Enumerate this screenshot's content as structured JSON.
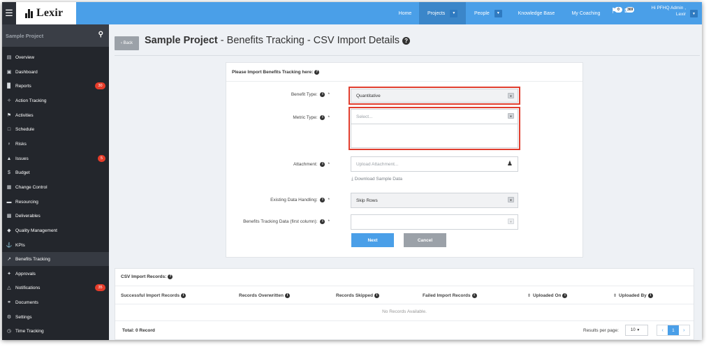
{
  "topbar": {
    "logo_text": "Lexir",
    "nav": [
      {
        "label": "Home"
      },
      {
        "label": "Projects"
      },
      {
        "label": "People"
      },
      {
        "label": "Knowledge Base"
      },
      {
        "label": "My Coaching"
      }
    ],
    "notifications_count": "0",
    "messages_count": "369",
    "user_greeting": "Hi PFHQ Admin ,",
    "user_company": "Lexir",
    "accent_color": "#4a9fe8"
  },
  "sidebar": {
    "search_label": "Sample Project",
    "items": [
      {
        "label": "Overview",
        "icon": "overview-icon"
      },
      {
        "label": "Dashboard",
        "icon": "dashboard-icon"
      },
      {
        "label": "Reports",
        "icon": "reports-icon",
        "badge": "30"
      },
      {
        "label": "Action Tracking",
        "icon": "action-tracking-icon"
      },
      {
        "label": "Activities",
        "icon": "activities-icon"
      },
      {
        "label": "Schedule",
        "icon": "calendar-icon"
      },
      {
        "label": "Risks",
        "icon": "risks-icon"
      },
      {
        "label": "Issues",
        "icon": "warning-icon",
        "badge": "5"
      },
      {
        "label": "Budget",
        "icon": "dollar-icon"
      },
      {
        "label": "Change Control",
        "icon": "change-control-icon"
      },
      {
        "label": "Resourcing",
        "icon": "folder-icon"
      },
      {
        "label": "Deliverables",
        "icon": "deliverables-icon"
      },
      {
        "label": "Quality Management",
        "icon": "tag-icon"
      },
      {
        "label": "KPIs",
        "icon": "anchor-icon"
      },
      {
        "label": "Benefits Tracking",
        "icon": "chart-line-icon"
      },
      {
        "label": "Approvals",
        "icon": "approvals-icon"
      },
      {
        "label": "Notifications",
        "icon": "bell-icon",
        "badge": "35"
      },
      {
        "label": "Documents",
        "icon": "documents-icon"
      },
      {
        "label": "Settings",
        "icon": "gear-icon"
      },
      {
        "label": "Time Tracking",
        "icon": "clock-icon"
      }
    ],
    "active_item": "Benefits Tracking"
  },
  "header": {
    "back_label": "Back",
    "project": "Sample Project",
    "subtitle": " - Benefits Tracking - CSV Import Details"
  },
  "form": {
    "title": "Please Import Benefits Tracking here:",
    "benefit_type_label": "Benefit Type:",
    "benefit_type_value": "Quantitative",
    "metric_type_label": "Metric Type:",
    "metric_type_placeholder": "Select...",
    "attachment_label": "Attachment:",
    "attachment_placeholder": "Upload Attachment...",
    "download_sample": "Download Sample Data",
    "existing_label": "Existing Data Handling:",
    "existing_value": "Skip Rows",
    "first_column_label": "Benefits Tracking Data (first column):",
    "first_column_value": "",
    "next_label": "Next",
    "cancel_label": "Cancel"
  },
  "records": {
    "title": "CSV Import Records:",
    "columns": [
      "Successful Import Records",
      "Records Overwritten",
      "Records Skipped",
      "Failed Import Records",
      "Uploaded On",
      "Uploaded By"
    ],
    "empty_text": "No Records Available.",
    "total": "Total: 0 Record",
    "results_per_page_label": "Results per page:",
    "results_per_page_value": "10",
    "current_page": "1"
  }
}
